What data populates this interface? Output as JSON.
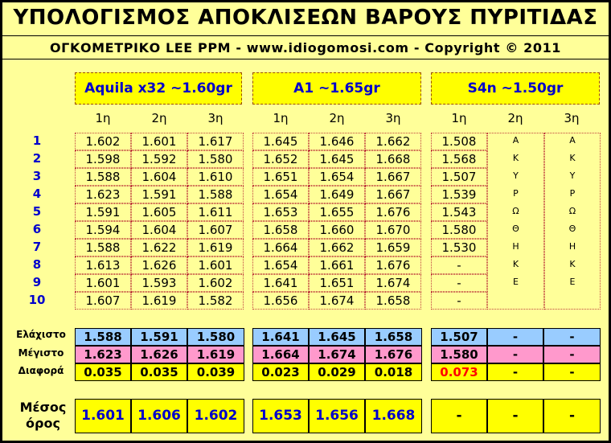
{
  "header": {
    "title": "ΥΠΟΛΟΓΙΣΜΟΣ ΑΠΟΚΛΙΣΕΩΝ ΒΑΡΟΥΣ ΠΥΡΙΤΙΔΑΣ",
    "subtitle": "ΟΓΚΟΜΕΤΡΙΚΟ LEE PPM  -   www.idiogomosi.com   -   Copyright © 2011"
  },
  "groups": [
    {
      "title": "Aquila x32 ~1.60gr",
      "cols": [
        "1η",
        "2η",
        "3η"
      ]
    },
    {
      "title": "A1 ~1.65gr",
      "cols": [
        "1η",
        "2η",
        "3η"
      ]
    },
    {
      "title": "S4n ~1.50gr",
      "cols": [
        "1η",
        "2η",
        "3η"
      ]
    }
  ],
  "row_labels": [
    "1",
    "2",
    "3",
    "4",
    "5",
    "6",
    "7",
    "8",
    "9",
    "10"
  ],
  "aquila": [
    [
      "1.602",
      "1.601",
      "1.617"
    ],
    [
      "1.598",
      "1.592",
      "1.580"
    ],
    [
      "1.588",
      "1.604",
      "1.610"
    ],
    [
      "1.623",
      "1.591",
      "1.588"
    ],
    [
      "1.591",
      "1.605",
      "1.611"
    ],
    [
      "1.594",
      "1.604",
      "1.607"
    ],
    [
      "1.588",
      "1.622",
      "1.619"
    ],
    [
      "1.613",
      "1.626",
      "1.601"
    ],
    [
      "1.601",
      "1.593",
      "1.602"
    ],
    [
      "1.607",
      "1.619",
      "1.582"
    ]
  ],
  "a1": [
    [
      "1.645",
      "1.646",
      "1.662"
    ],
    [
      "1.652",
      "1.645",
      "1.668"
    ],
    [
      "1.651",
      "1.654",
      "1.667"
    ],
    [
      "1.654",
      "1.649",
      "1.667"
    ],
    [
      "1.653",
      "1.655",
      "1.676"
    ],
    [
      "1.658",
      "1.660",
      "1.670"
    ],
    [
      "1.664",
      "1.662",
      "1.659"
    ],
    [
      "1.654",
      "1.661",
      "1.676"
    ],
    [
      "1.641",
      "1.651",
      "1.674"
    ],
    [
      "1.656",
      "1.674",
      "1.658"
    ]
  ],
  "s4n": {
    "col1": [
      "1.508",
      "1.568",
      "1.507",
      "1.539",
      "1.543",
      "1.580",
      "1.530",
      "-",
      "-",
      "-"
    ],
    "col2": [
      "Α",
      "Κ",
      "Υ",
      "Ρ",
      "Ω",
      "Θ",
      "Η",
      "Κ",
      "Ε"
    ],
    "col3": [
      "Α",
      "Κ",
      "Υ",
      "Ρ",
      "Ω",
      "Θ",
      "Η",
      "Κ",
      "Ε"
    ]
  },
  "stats": {
    "labels": {
      "min": "Ελάχιστο",
      "max": "Μέγιστο",
      "diff": "Διαφορά"
    },
    "aquila": {
      "min": [
        "1.588",
        "1.591",
        "1.580"
      ],
      "max": [
        "1.623",
        "1.626",
        "1.619"
      ],
      "diff": [
        "0.035",
        "0.035",
        "0.039"
      ]
    },
    "a1": {
      "min": [
        "1.641",
        "1.645",
        "1.658"
      ],
      "max": [
        "1.664",
        "1.674",
        "1.676"
      ],
      "diff": [
        "0.023",
        "0.029",
        "0.018"
      ]
    },
    "s4n": {
      "min": [
        "1.507",
        "-",
        "-"
      ],
      "max": [
        "1.580",
        "-",
        "-"
      ],
      "diff": [
        "0.073",
        "-",
        "-"
      ]
    }
  },
  "mean": {
    "label_line1": "Μέσος",
    "label_line2": "όρος",
    "aquila": [
      "1.601",
      "1.606",
      "1.602"
    ],
    "a1": [
      "1.653",
      "1.656",
      "1.668"
    ],
    "s4n": [
      "-",
      "-",
      "-"
    ]
  },
  "colors": {
    "background": "#ffff99",
    "title_box": "#ffff00",
    "min": "#99ccff",
    "max": "#ff99cc",
    "diff": "#ffff00",
    "highlight": "#ff0000"
  }
}
